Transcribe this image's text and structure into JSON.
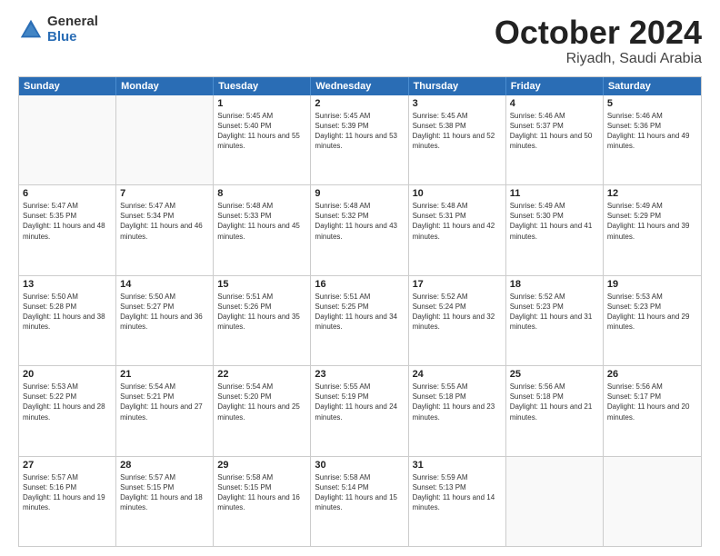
{
  "logo": {
    "general": "General",
    "blue": "Blue"
  },
  "title": {
    "month": "October 2024",
    "location": "Riyadh, Saudi Arabia"
  },
  "header_days": [
    "Sunday",
    "Monday",
    "Tuesday",
    "Wednesday",
    "Thursday",
    "Friday",
    "Saturday"
  ],
  "weeks": [
    [
      {
        "day": "",
        "sunrise": "",
        "sunset": "",
        "daylight": ""
      },
      {
        "day": "",
        "sunrise": "",
        "sunset": "",
        "daylight": ""
      },
      {
        "day": "1",
        "sunrise": "Sunrise: 5:45 AM",
        "sunset": "Sunset: 5:40 PM",
        "daylight": "Daylight: 11 hours and 55 minutes."
      },
      {
        "day": "2",
        "sunrise": "Sunrise: 5:45 AM",
        "sunset": "Sunset: 5:39 PM",
        "daylight": "Daylight: 11 hours and 53 minutes."
      },
      {
        "day": "3",
        "sunrise": "Sunrise: 5:45 AM",
        "sunset": "Sunset: 5:38 PM",
        "daylight": "Daylight: 11 hours and 52 minutes."
      },
      {
        "day": "4",
        "sunrise": "Sunrise: 5:46 AM",
        "sunset": "Sunset: 5:37 PM",
        "daylight": "Daylight: 11 hours and 50 minutes."
      },
      {
        "day": "5",
        "sunrise": "Sunrise: 5:46 AM",
        "sunset": "Sunset: 5:36 PM",
        "daylight": "Daylight: 11 hours and 49 minutes."
      }
    ],
    [
      {
        "day": "6",
        "sunrise": "Sunrise: 5:47 AM",
        "sunset": "Sunset: 5:35 PM",
        "daylight": "Daylight: 11 hours and 48 minutes."
      },
      {
        "day": "7",
        "sunrise": "Sunrise: 5:47 AM",
        "sunset": "Sunset: 5:34 PM",
        "daylight": "Daylight: 11 hours and 46 minutes."
      },
      {
        "day": "8",
        "sunrise": "Sunrise: 5:48 AM",
        "sunset": "Sunset: 5:33 PM",
        "daylight": "Daylight: 11 hours and 45 minutes."
      },
      {
        "day": "9",
        "sunrise": "Sunrise: 5:48 AM",
        "sunset": "Sunset: 5:32 PM",
        "daylight": "Daylight: 11 hours and 43 minutes."
      },
      {
        "day": "10",
        "sunrise": "Sunrise: 5:48 AM",
        "sunset": "Sunset: 5:31 PM",
        "daylight": "Daylight: 11 hours and 42 minutes."
      },
      {
        "day": "11",
        "sunrise": "Sunrise: 5:49 AM",
        "sunset": "Sunset: 5:30 PM",
        "daylight": "Daylight: 11 hours and 41 minutes."
      },
      {
        "day": "12",
        "sunrise": "Sunrise: 5:49 AM",
        "sunset": "Sunset: 5:29 PM",
        "daylight": "Daylight: 11 hours and 39 minutes."
      }
    ],
    [
      {
        "day": "13",
        "sunrise": "Sunrise: 5:50 AM",
        "sunset": "Sunset: 5:28 PM",
        "daylight": "Daylight: 11 hours and 38 minutes."
      },
      {
        "day": "14",
        "sunrise": "Sunrise: 5:50 AM",
        "sunset": "Sunset: 5:27 PM",
        "daylight": "Daylight: 11 hours and 36 minutes."
      },
      {
        "day": "15",
        "sunrise": "Sunrise: 5:51 AM",
        "sunset": "Sunset: 5:26 PM",
        "daylight": "Daylight: 11 hours and 35 minutes."
      },
      {
        "day": "16",
        "sunrise": "Sunrise: 5:51 AM",
        "sunset": "Sunset: 5:25 PM",
        "daylight": "Daylight: 11 hours and 34 minutes."
      },
      {
        "day": "17",
        "sunrise": "Sunrise: 5:52 AM",
        "sunset": "Sunset: 5:24 PM",
        "daylight": "Daylight: 11 hours and 32 minutes."
      },
      {
        "day": "18",
        "sunrise": "Sunrise: 5:52 AM",
        "sunset": "Sunset: 5:23 PM",
        "daylight": "Daylight: 11 hours and 31 minutes."
      },
      {
        "day": "19",
        "sunrise": "Sunrise: 5:53 AM",
        "sunset": "Sunset: 5:23 PM",
        "daylight": "Daylight: 11 hours and 29 minutes."
      }
    ],
    [
      {
        "day": "20",
        "sunrise": "Sunrise: 5:53 AM",
        "sunset": "Sunset: 5:22 PM",
        "daylight": "Daylight: 11 hours and 28 minutes."
      },
      {
        "day": "21",
        "sunrise": "Sunrise: 5:54 AM",
        "sunset": "Sunset: 5:21 PM",
        "daylight": "Daylight: 11 hours and 27 minutes."
      },
      {
        "day": "22",
        "sunrise": "Sunrise: 5:54 AM",
        "sunset": "Sunset: 5:20 PM",
        "daylight": "Daylight: 11 hours and 25 minutes."
      },
      {
        "day": "23",
        "sunrise": "Sunrise: 5:55 AM",
        "sunset": "Sunset: 5:19 PM",
        "daylight": "Daylight: 11 hours and 24 minutes."
      },
      {
        "day": "24",
        "sunrise": "Sunrise: 5:55 AM",
        "sunset": "Sunset: 5:18 PM",
        "daylight": "Daylight: 11 hours and 23 minutes."
      },
      {
        "day": "25",
        "sunrise": "Sunrise: 5:56 AM",
        "sunset": "Sunset: 5:18 PM",
        "daylight": "Daylight: 11 hours and 21 minutes."
      },
      {
        "day": "26",
        "sunrise": "Sunrise: 5:56 AM",
        "sunset": "Sunset: 5:17 PM",
        "daylight": "Daylight: 11 hours and 20 minutes."
      }
    ],
    [
      {
        "day": "27",
        "sunrise": "Sunrise: 5:57 AM",
        "sunset": "Sunset: 5:16 PM",
        "daylight": "Daylight: 11 hours and 19 minutes."
      },
      {
        "day": "28",
        "sunrise": "Sunrise: 5:57 AM",
        "sunset": "Sunset: 5:15 PM",
        "daylight": "Daylight: 11 hours and 18 minutes."
      },
      {
        "day": "29",
        "sunrise": "Sunrise: 5:58 AM",
        "sunset": "Sunset: 5:15 PM",
        "daylight": "Daylight: 11 hours and 16 minutes."
      },
      {
        "day": "30",
        "sunrise": "Sunrise: 5:58 AM",
        "sunset": "Sunset: 5:14 PM",
        "daylight": "Daylight: 11 hours and 15 minutes."
      },
      {
        "day": "31",
        "sunrise": "Sunrise: 5:59 AM",
        "sunset": "Sunset: 5:13 PM",
        "daylight": "Daylight: 11 hours and 14 minutes."
      },
      {
        "day": "",
        "sunrise": "",
        "sunset": "",
        "daylight": ""
      },
      {
        "day": "",
        "sunrise": "",
        "sunset": "",
        "daylight": ""
      }
    ]
  ]
}
